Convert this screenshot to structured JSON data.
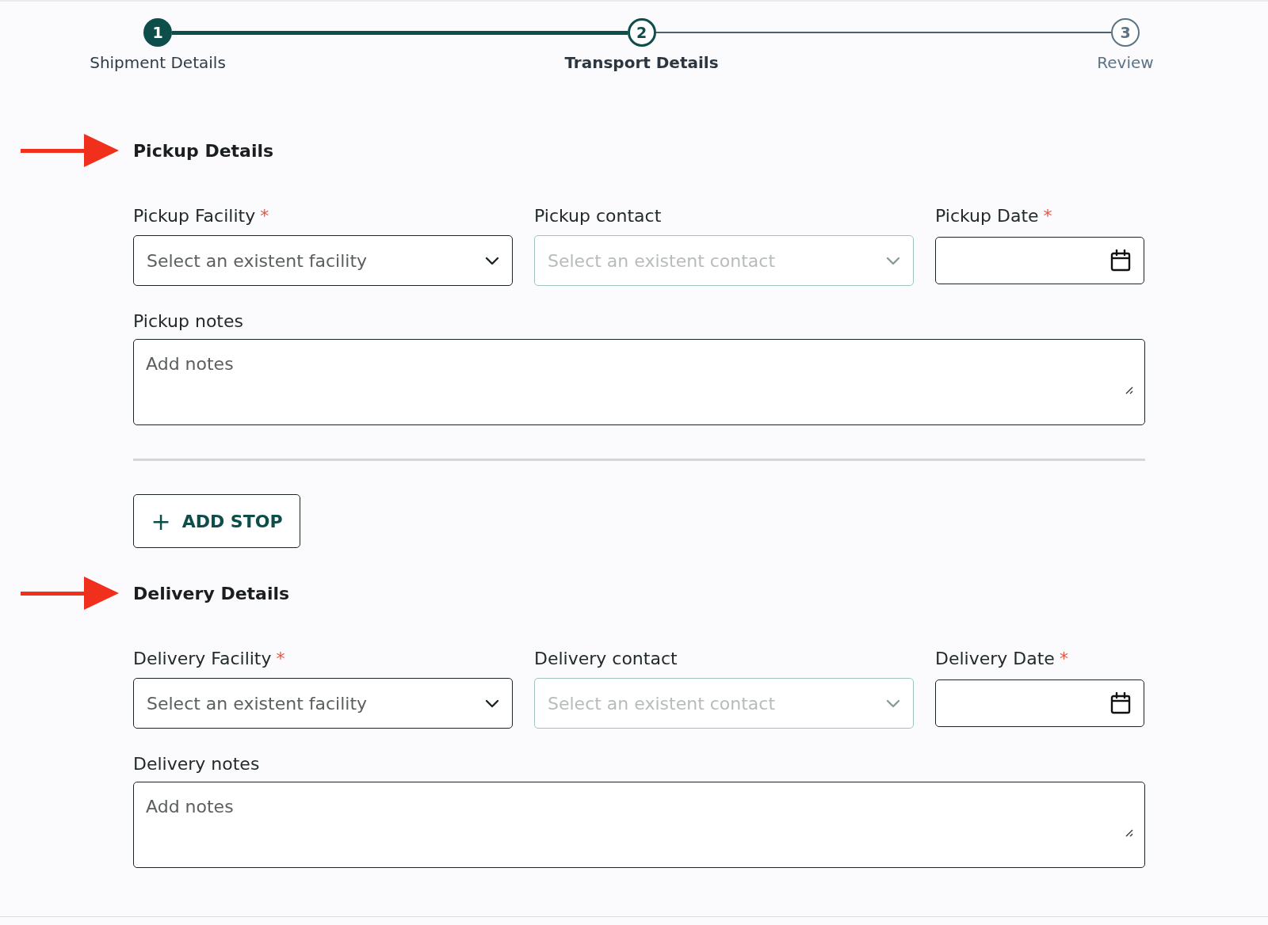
{
  "stepper": [
    {
      "number": "1",
      "label": "Shipment Details",
      "completed": true,
      "selected": false
    },
    {
      "number": "2",
      "label": "Transport Details",
      "completed": false,
      "selected": true
    },
    {
      "number": "3",
      "label": "Review",
      "completed": false,
      "selected": false
    }
  ],
  "sections": [
    {
      "kind": "stop",
      "title": "Pickup Details",
      "highlighted": true,
      "fields": [
        {
          "kind": "select",
          "label": "Pickup Facility",
          "required_mark": "*",
          "placeholder": "Select an existent facility",
          "disabled": false
        },
        {
          "kind": "select",
          "label": "Pickup contact",
          "placeholder": "Select an existent contact",
          "disabled": true
        },
        {
          "kind": "date",
          "label": "Pickup Date",
          "required_mark": "*",
          "disabled": false
        }
      ],
      "notes": {
        "label": "Pickup notes",
        "placeholder": "Add notes"
      }
    },
    {
      "kind": "add",
      "button": {
        "icon": "+",
        "label": "ADD STOP"
      }
    },
    {
      "kind": "stop",
      "title": "Delivery Details",
      "highlighted": true,
      "fields": [
        {
          "kind": "select",
          "label": "Delivery Facility",
          "required_mark": "*",
          "placeholder": "Select an existent facility",
          "disabled": false
        },
        {
          "kind": "select",
          "label": "Delivery contact",
          "placeholder": "Select an existent contact",
          "disabled": true
        },
        {
          "kind": "date",
          "label": "Delivery Date",
          "required_mark": "*",
          "disabled": false
        }
      ],
      "notes": {
        "label": "Delivery notes",
        "placeholder": "Add notes"
      }
    }
  ]
}
